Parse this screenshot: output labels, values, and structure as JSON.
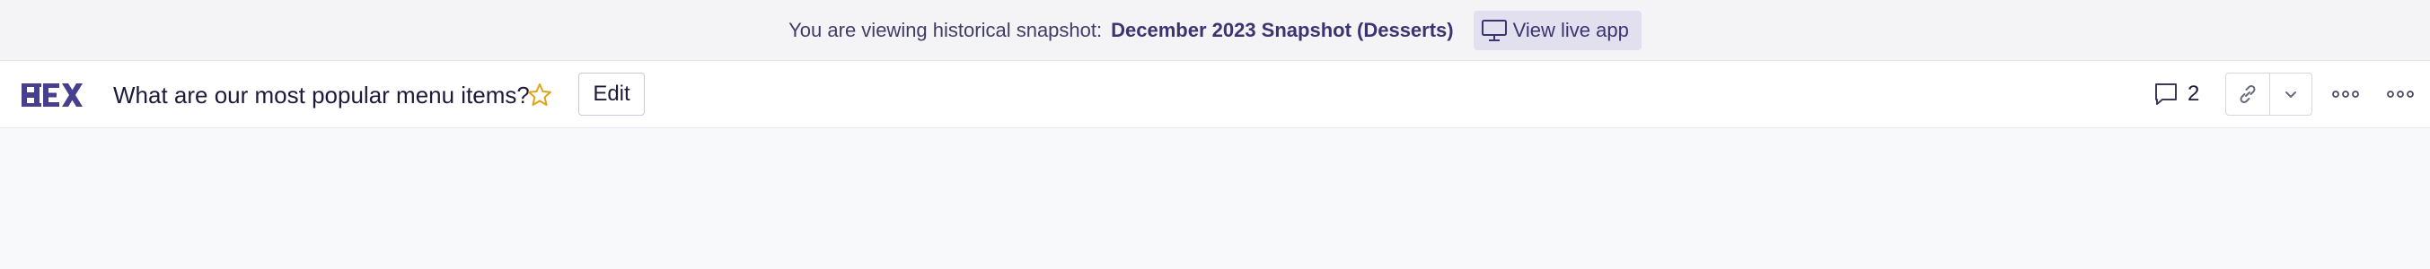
{
  "banner": {
    "prefix": "You are viewing historical snapshot:",
    "snapshot_name": "December 2023 Snapshot (Desserts)",
    "view_live_label": "View live app",
    "view_live_icon": "monitor-icon"
  },
  "header": {
    "logo_text": "HEX",
    "title": "What are our most popular menu items?",
    "star_icon": "star-icon",
    "edit_label": "Edit",
    "comments_icon": "comment-icon",
    "comments_count": "2",
    "share_icon": "link-icon",
    "dropdown_icon": "chevron-down-icon",
    "more_icon": "more-horizontal-icon"
  },
  "colors": {
    "brand": "#473f8e",
    "star": "#e0a418",
    "text": "#1d1b3a",
    "banner_bg": "#f4f4f7",
    "button_bg": "#e2e0ee"
  }
}
